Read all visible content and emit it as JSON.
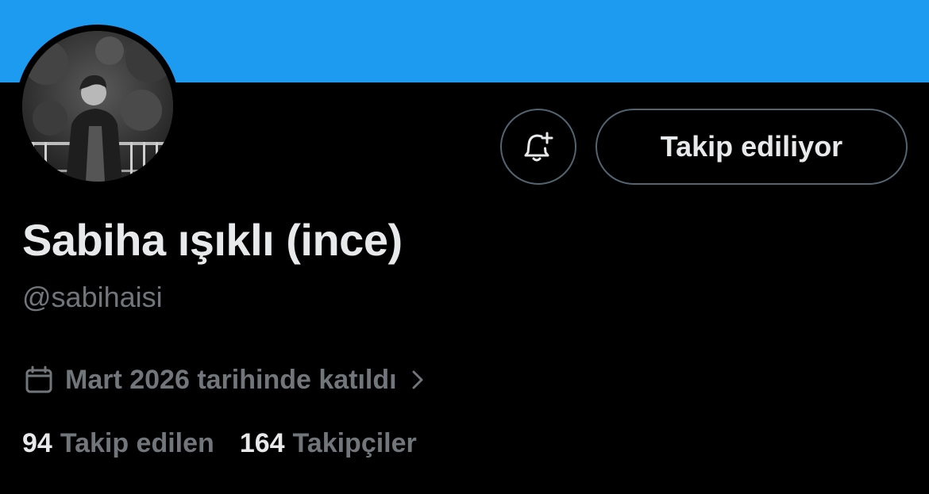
{
  "profile": {
    "display_name": "Sabiha ışıklı (ince)",
    "handle": "@sabihaisi",
    "joined": "Mart 2026 tarihinde katıldı",
    "avatar": "profile-photo"
  },
  "actions": {
    "notify_icon": "bell-plus-icon",
    "follow_label": "Takip ediliyor"
  },
  "stats": {
    "following_count": "94",
    "following_label": "Takip edilen",
    "followers_count": "164",
    "followers_label": "Takipçiler"
  },
  "colors": {
    "banner": "#1d9bf0",
    "background": "#000000",
    "primary_text": "#e7e9ea",
    "secondary_text": "#71767b",
    "border": "#536471"
  }
}
